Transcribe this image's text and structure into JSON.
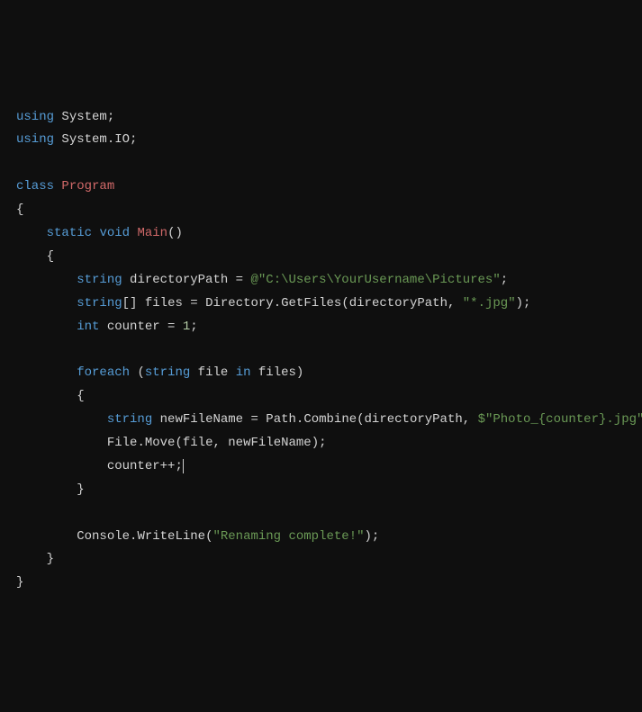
{
  "code": {
    "line1_using": "using",
    "line1_ns": "System",
    "line2_using": "using",
    "line2_ns": "System.IO",
    "class_kw": "class",
    "class_name": "Program",
    "static_kw": "static",
    "void_kw": "void",
    "main_name": "Main",
    "string_kw": "string",
    "dirpath_var": "directoryPath",
    "dirpath_val": "@\"C:\\Users\\YourUsername\\Pictures\"",
    "files_var": "files",
    "directory_cls": "Directory",
    "getfiles_m": "GetFiles",
    "pattern_val": "\"*.jpg\"",
    "int_kw": "int",
    "counter_var": "counter",
    "counter_val": "1",
    "foreach_kw": "foreach",
    "in_kw": "in",
    "file_var": "file",
    "newfilename_var": "newFileName",
    "path_cls": "Path",
    "combine_m": "Combine",
    "photo_interp": "$\"Photo_{counter}.jpg\"",
    "file_cls": "File",
    "move_m": "Move",
    "counter_inc": "counter++",
    "console_cls": "Console",
    "writeline_m": "WriteLine",
    "done_msg": "\"Renaming complete!\"",
    "semi": ";",
    "lbrace": "{",
    "rbrace": "}",
    "lparen": "(",
    "rparen": ")",
    "lbracket": "[",
    "rbracket": "]",
    "eq": " = ",
    "dot": ".",
    "comma": ", "
  }
}
